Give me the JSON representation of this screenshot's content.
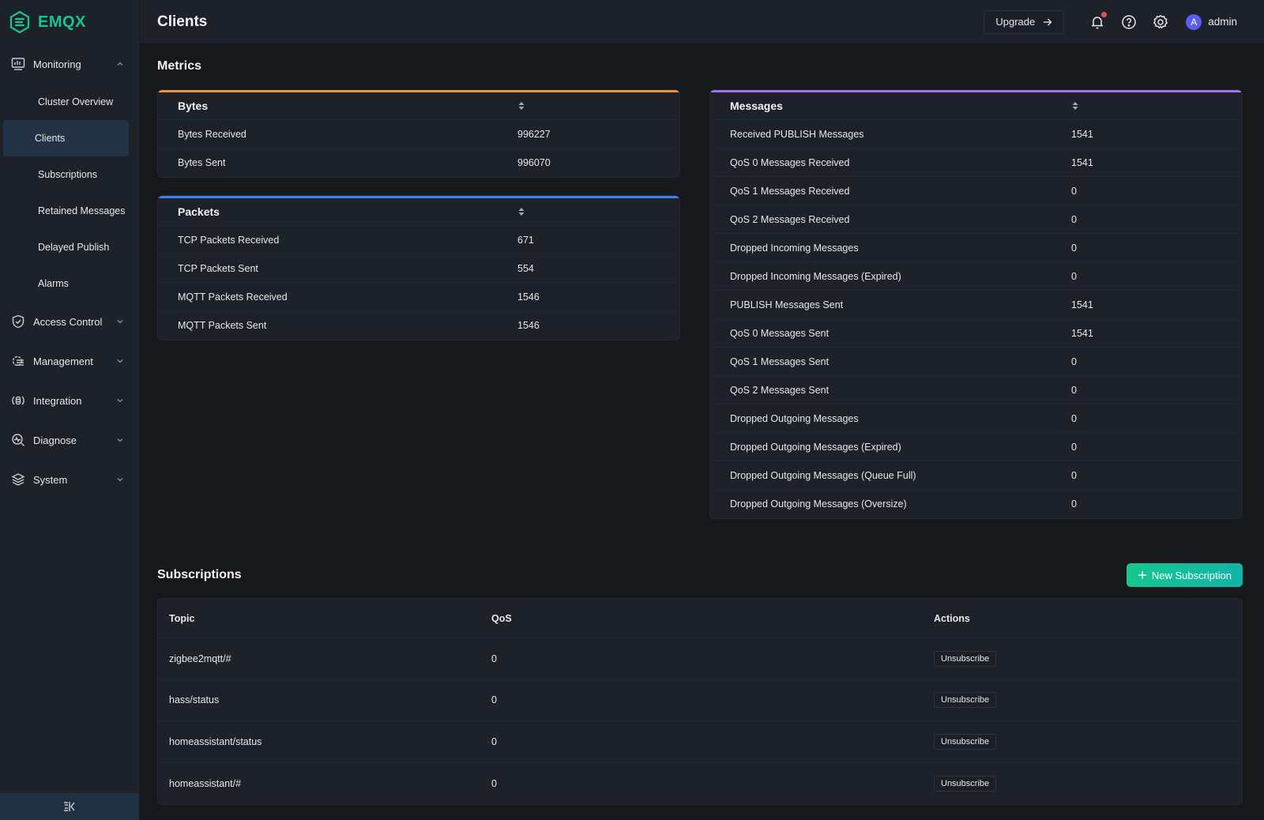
{
  "app": {
    "name": "EMQX",
    "brand_color": "#19c58f"
  },
  "sidebar": {
    "groups": [
      {
        "label": "Monitoring",
        "icon": "monitor-chart-icon",
        "expanded": true,
        "items": [
          {
            "label": "Cluster Overview",
            "active": false
          },
          {
            "label": "Clients",
            "active": true
          },
          {
            "label": "Subscriptions",
            "active": false
          },
          {
            "label": "Retained Messages",
            "active": false
          },
          {
            "label": "Delayed Publish",
            "active": false
          },
          {
            "label": "Alarms",
            "active": false
          }
        ]
      },
      {
        "label": "Access Control",
        "icon": "shield-check-icon",
        "expanded": false
      },
      {
        "label": "Management",
        "icon": "gear-list-icon",
        "expanded": false
      },
      {
        "label": "Integration",
        "icon": "database-sync-icon",
        "expanded": false
      },
      {
        "label": "Diagnose",
        "icon": "search-pulse-icon",
        "expanded": false
      },
      {
        "label": "System",
        "icon": "layers-icon",
        "expanded": false
      }
    ],
    "collapse_icon": "collapse-sidebar-icon"
  },
  "header": {
    "title": "Clients",
    "upgrade_label": "Upgrade",
    "has_notification": true,
    "user": {
      "initial": "A",
      "name": "admin"
    }
  },
  "metrics": {
    "title": "Metrics",
    "bytes": {
      "title": "Bytes",
      "accent": "#f0913a",
      "rows": [
        {
          "label": "Bytes Received",
          "value": "996227"
        },
        {
          "label": "Bytes Sent",
          "value": "996070"
        }
      ]
    },
    "packets": {
      "title": "Packets",
      "accent": "#3b82f0",
      "rows": [
        {
          "label": "TCP Packets Received",
          "value": "671"
        },
        {
          "label": "TCP Packets Sent",
          "value": "554"
        },
        {
          "label": "MQTT Packets Received",
          "value": "1546"
        },
        {
          "label": "MQTT Packets Sent",
          "value": "1546"
        }
      ]
    },
    "messages": {
      "title": "Messages",
      "accent": "#a86ef0",
      "rows": [
        {
          "label": "Received PUBLISH Messages",
          "value": "1541"
        },
        {
          "label": "QoS 0 Messages Received",
          "value": "1541"
        },
        {
          "label": "QoS 1 Messages Received",
          "value": "0"
        },
        {
          "label": "QoS 2 Messages Received",
          "value": "0"
        },
        {
          "label": "Dropped Incoming Messages",
          "value": "0"
        },
        {
          "label": "Dropped Incoming Messages (Expired)",
          "value": "0"
        },
        {
          "label": "PUBLISH Messages Sent",
          "value": "1541"
        },
        {
          "label": "QoS 0 Messages Sent",
          "value": "1541"
        },
        {
          "label": "QoS 1 Messages Sent",
          "value": "0"
        },
        {
          "label": "QoS 2 Messages Sent",
          "value": "0"
        },
        {
          "label": "Dropped Outgoing Messages",
          "value": "0"
        },
        {
          "label": "Dropped Outgoing Messages (Expired)",
          "value": "0"
        },
        {
          "label": "Dropped Outgoing Messages (Queue Full)",
          "value": "0"
        },
        {
          "label": "Dropped Outgoing Messages (Oversize)",
          "value": "0"
        }
      ]
    }
  },
  "subscriptions": {
    "title": "Subscriptions",
    "new_button_label": "New Subscription",
    "columns": [
      "Topic",
      "QoS",
      "Actions"
    ],
    "rows": [
      {
        "topic": "zigbee2mqtt/#",
        "qos": "0",
        "action": "Unsubscribe"
      },
      {
        "topic": "hass/status",
        "qos": "0",
        "action": "Unsubscribe"
      },
      {
        "topic": "homeassistant/status",
        "qos": "0",
        "action": "Unsubscribe"
      },
      {
        "topic": "homeassistant/#",
        "qos": "0",
        "action": "Unsubscribe"
      }
    ]
  }
}
